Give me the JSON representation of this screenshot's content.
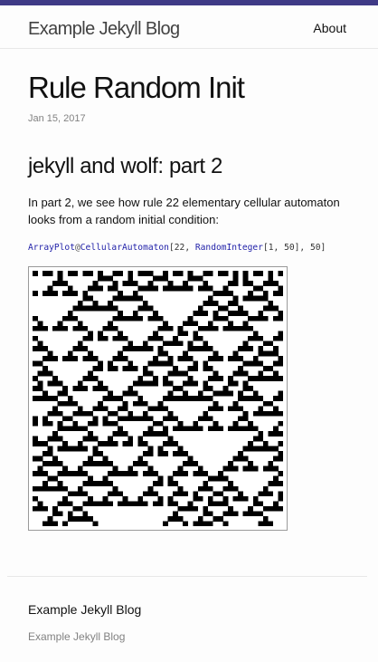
{
  "colors": {
    "accent_bar": "#3f3a86",
    "header_border": "#e8e8e8",
    "meta_text": "#828282",
    "code_function": "#1f1fa8"
  },
  "header": {
    "site_title": "Example Jekyll Blog",
    "nav": [
      {
        "label": "About"
      }
    ]
  },
  "post": {
    "title": "Rule Random Init",
    "date": "Jan 15, 2017",
    "heading": "jekyll and wolf: part 2",
    "paragraph": "In part 2, we see how rule 22 elementary cellular automaton looks from a random initial condition:",
    "code": {
      "fn1": "ArrayPlot",
      "op": "@",
      "fn2": "CellularAutomaton",
      "open1": "[",
      "rule": "22",
      "sep1": ", ",
      "fn3": "RandomInteger",
      "args": "[1, 50]",
      "sep2": ", ",
      "steps": "50",
      "close1": "]"
    },
    "figure": {
      "rule": 22,
      "width": 50,
      "steps": 51,
      "initial_row": [
        1,
        0,
        1,
        1,
        0,
        1,
        0,
        1,
        1,
        0,
        1,
        1,
        0,
        1,
        0,
        0,
        1,
        1,
        0,
        1,
        0,
        1,
        1,
        1,
        0,
        0,
        1,
        0,
        1,
        1,
        0,
        1,
        0,
        0,
        1,
        1,
        0,
        1,
        1,
        0,
        1,
        0,
        1,
        0,
        1,
        1,
        0,
        1,
        0,
        1
      ]
    }
  },
  "footer": {
    "title": "Example Jekyll Blog",
    "subtitle": "Example Jekyll Blog"
  }
}
